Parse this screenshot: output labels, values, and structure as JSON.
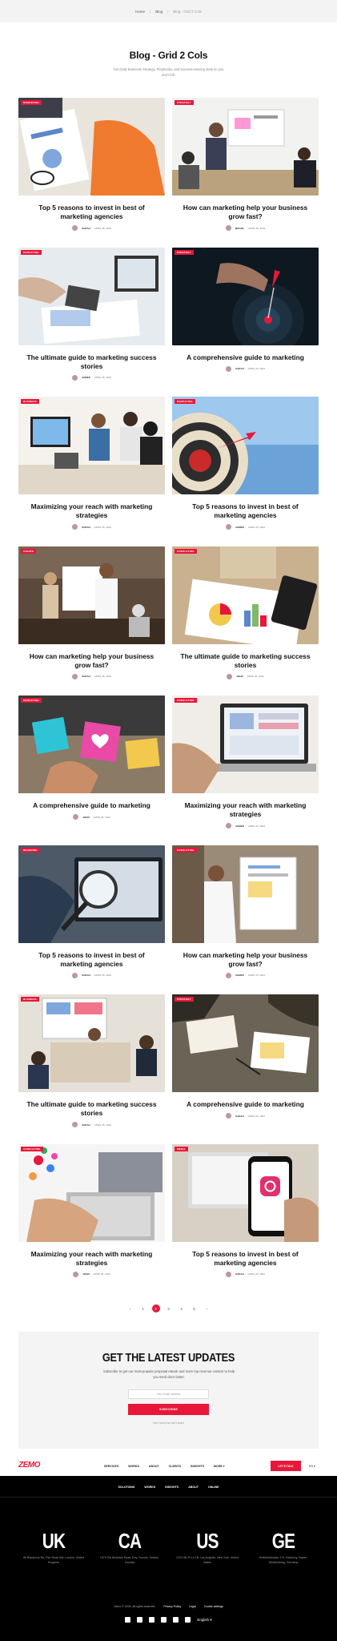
{
  "breadcrumb": {
    "home": "Home",
    "blog": "Blog",
    "current": "Blog - Grid 2 Cols"
  },
  "page": {
    "title": "Blog - Grid 2 Cols",
    "subtitle": "Get Daily Business Strategy, Playbooks, and success winning stats so you don't fall."
  },
  "posts": [
    {
      "tag": "Marketing",
      "title": "Top 5 reasons to invest in best of marketing agencies",
      "author": "Sarah",
      "date": "April 25, 2024",
      "scene": "docs"
    },
    {
      "tag": "Strategy",
      "title": "How can marketing help your business grow fast?",
      "author": "Michel",
      "date": "April 25, 2024",
      "scene": "meeting"
    },
    {
      "tag": "Marketing",
      "title": "The ultimate guide to marketing success stories",
      "author": "Ahmed",
      "date": "April 25, 2024",
      "scene": "desk"
    },
    {
      "tag": "Strategy",
      "title": "A comprehensive guide to marketing",
      "author": "Sarah",
      "date": "April 25, 2024",
      "scene": "dart"
    },
    {
      "tag": "Business",
      "title": "Maximizing your reach with marketing strategies",
      "author": "Sarah",
      "date": "April 25, 2024",
      "scene": "team"
    },
    {
      "tag": "Marketing",
      "title": "Top 5 reasons to invest in best of marketing agencies",
      "author": "Ahmed",
      "date": "April 25, 2024",
      "scene": "target"
    },
    {
      "tag": "Events",
      "title": "How can marketing help your business grow fast?",
      "author": "Sarah",
      "date": "April 25, 2024",
      "scene": "office"
    },
    {
      "tag": "Consulting",
      "title": "The ultimate guide to marketing success stories",
      "author": "John",
      "date": "April 25, 2024",
      "scene": "charts"
    },
    {
      "tag": "Marketing",
      "title": "A comprehensive guide to marketing",
      "author": "John",
      "date": "April 25, 2024",
      "scene": "hearts"
    },
    {
      "tag": "Consulting",
      "title": "Maximizing your reach with marketing strategies",
      "author": "Ahmed",
      "date": "April 25, 2024",
      "scene": "laptop"
    },
    {
      "tag": "Branding",
      "title": "Top 5 reasons to invest in best of marketing agencies",
      "author": "Sarah",
      "date": "April 25, 2024",
      "scene": "magnify"
    },
    {
      "tag": "Consulting",
      "title": "How can marketing help your business grow fast?",
      "author": "Ahmed",
      "date": "April 25, 2024",
      "scene": "board"
    },
    {
      "tag": "Business",
      "title": "The ultimate guide to marketing success stories",
      "author": "Sarah",
      "date": "April 25, 2024",
      "scene": "group"
    },
    {
      "tag": "Strategy",
      "title": "A comprehensive guide to marketing",
      "author": "Sarah",
      "date": "April 25, 2024",
      "scene": "papers"
    },
    {
      "tag": "Consulting",
      "title": "Maximizing your reach with marketing strategies",
      "author": "John",
      "date": "April 25, 2024",
      "scene": "social"
    },
    {
      "tag": "Media",
      "title": "Top 5 reasons to invest in best of marketing agencies",
      "author": "Sarah",
      "date": "April 25, 2024",
      "scene": "phone"
    }
  ],
  "pagination": {
    "prev": "‹",
    "pages": [
      "1",
      "2",
      "3",
      "4",
      "5"
    ],
    "active": "2",
    "next": "›"
  },
  "newsletter": {
    "title": "GET THE LATEST UPDATES",
    "subtitle": "Subscribe to get our most-popular proposal eBook and more top revenue content to help you send docs faster.",
    "placeholder": "Your email address",
    "button": "SUBSCRIBE",
    "note": "Don't worry we don't spam"
  },
  "nav": {
    "logo": "ZEMO",
    "links": [
      "SERVICES",
      "WORKS",
      "ABOUT",
      "CLIENTS",
      "INSIGHTS",
      "MORE ▾"
    ],
    "cta": "LET'S TALK",
    "lang": "EN ▾"
  },
  "footer": {
    "links": [
      "SOLUTIONS",
      "WORKS",
      "INSIGHTS",
      "ABOUT",
      "ONLINE"
    ],
    "offices": [
      {
        "code": "UK",
        "address": "88 Blackcock Rd, Parr Road Mill, London, United Kingdom"
      },
      {
        "code": "CA",
        "address": "1979 Old Bostwick Road, Roy, Toronto, Ontario, Canada"
      },
      {
        "code": "US",
        "address": "1120 Ute Pl Ln 1B, Los Angeles, New York, United States"
      },
      {
        "code": "GE",
        "address": "Heilwerkstrasse 179, Hamburg, Baden-Württemberg, Germany"
      }
    ],
    "copyright": "Zemo © 2024. All rights reserved.",
    "legal": [
      "Privacy Policy",
      "Legal",
      "Cookie settings"
    ],
    "language": "English ▾"
  },
  "colors": {
    "accent": "#e8173a",
    "footer_bg": "#000000"
  }
}
